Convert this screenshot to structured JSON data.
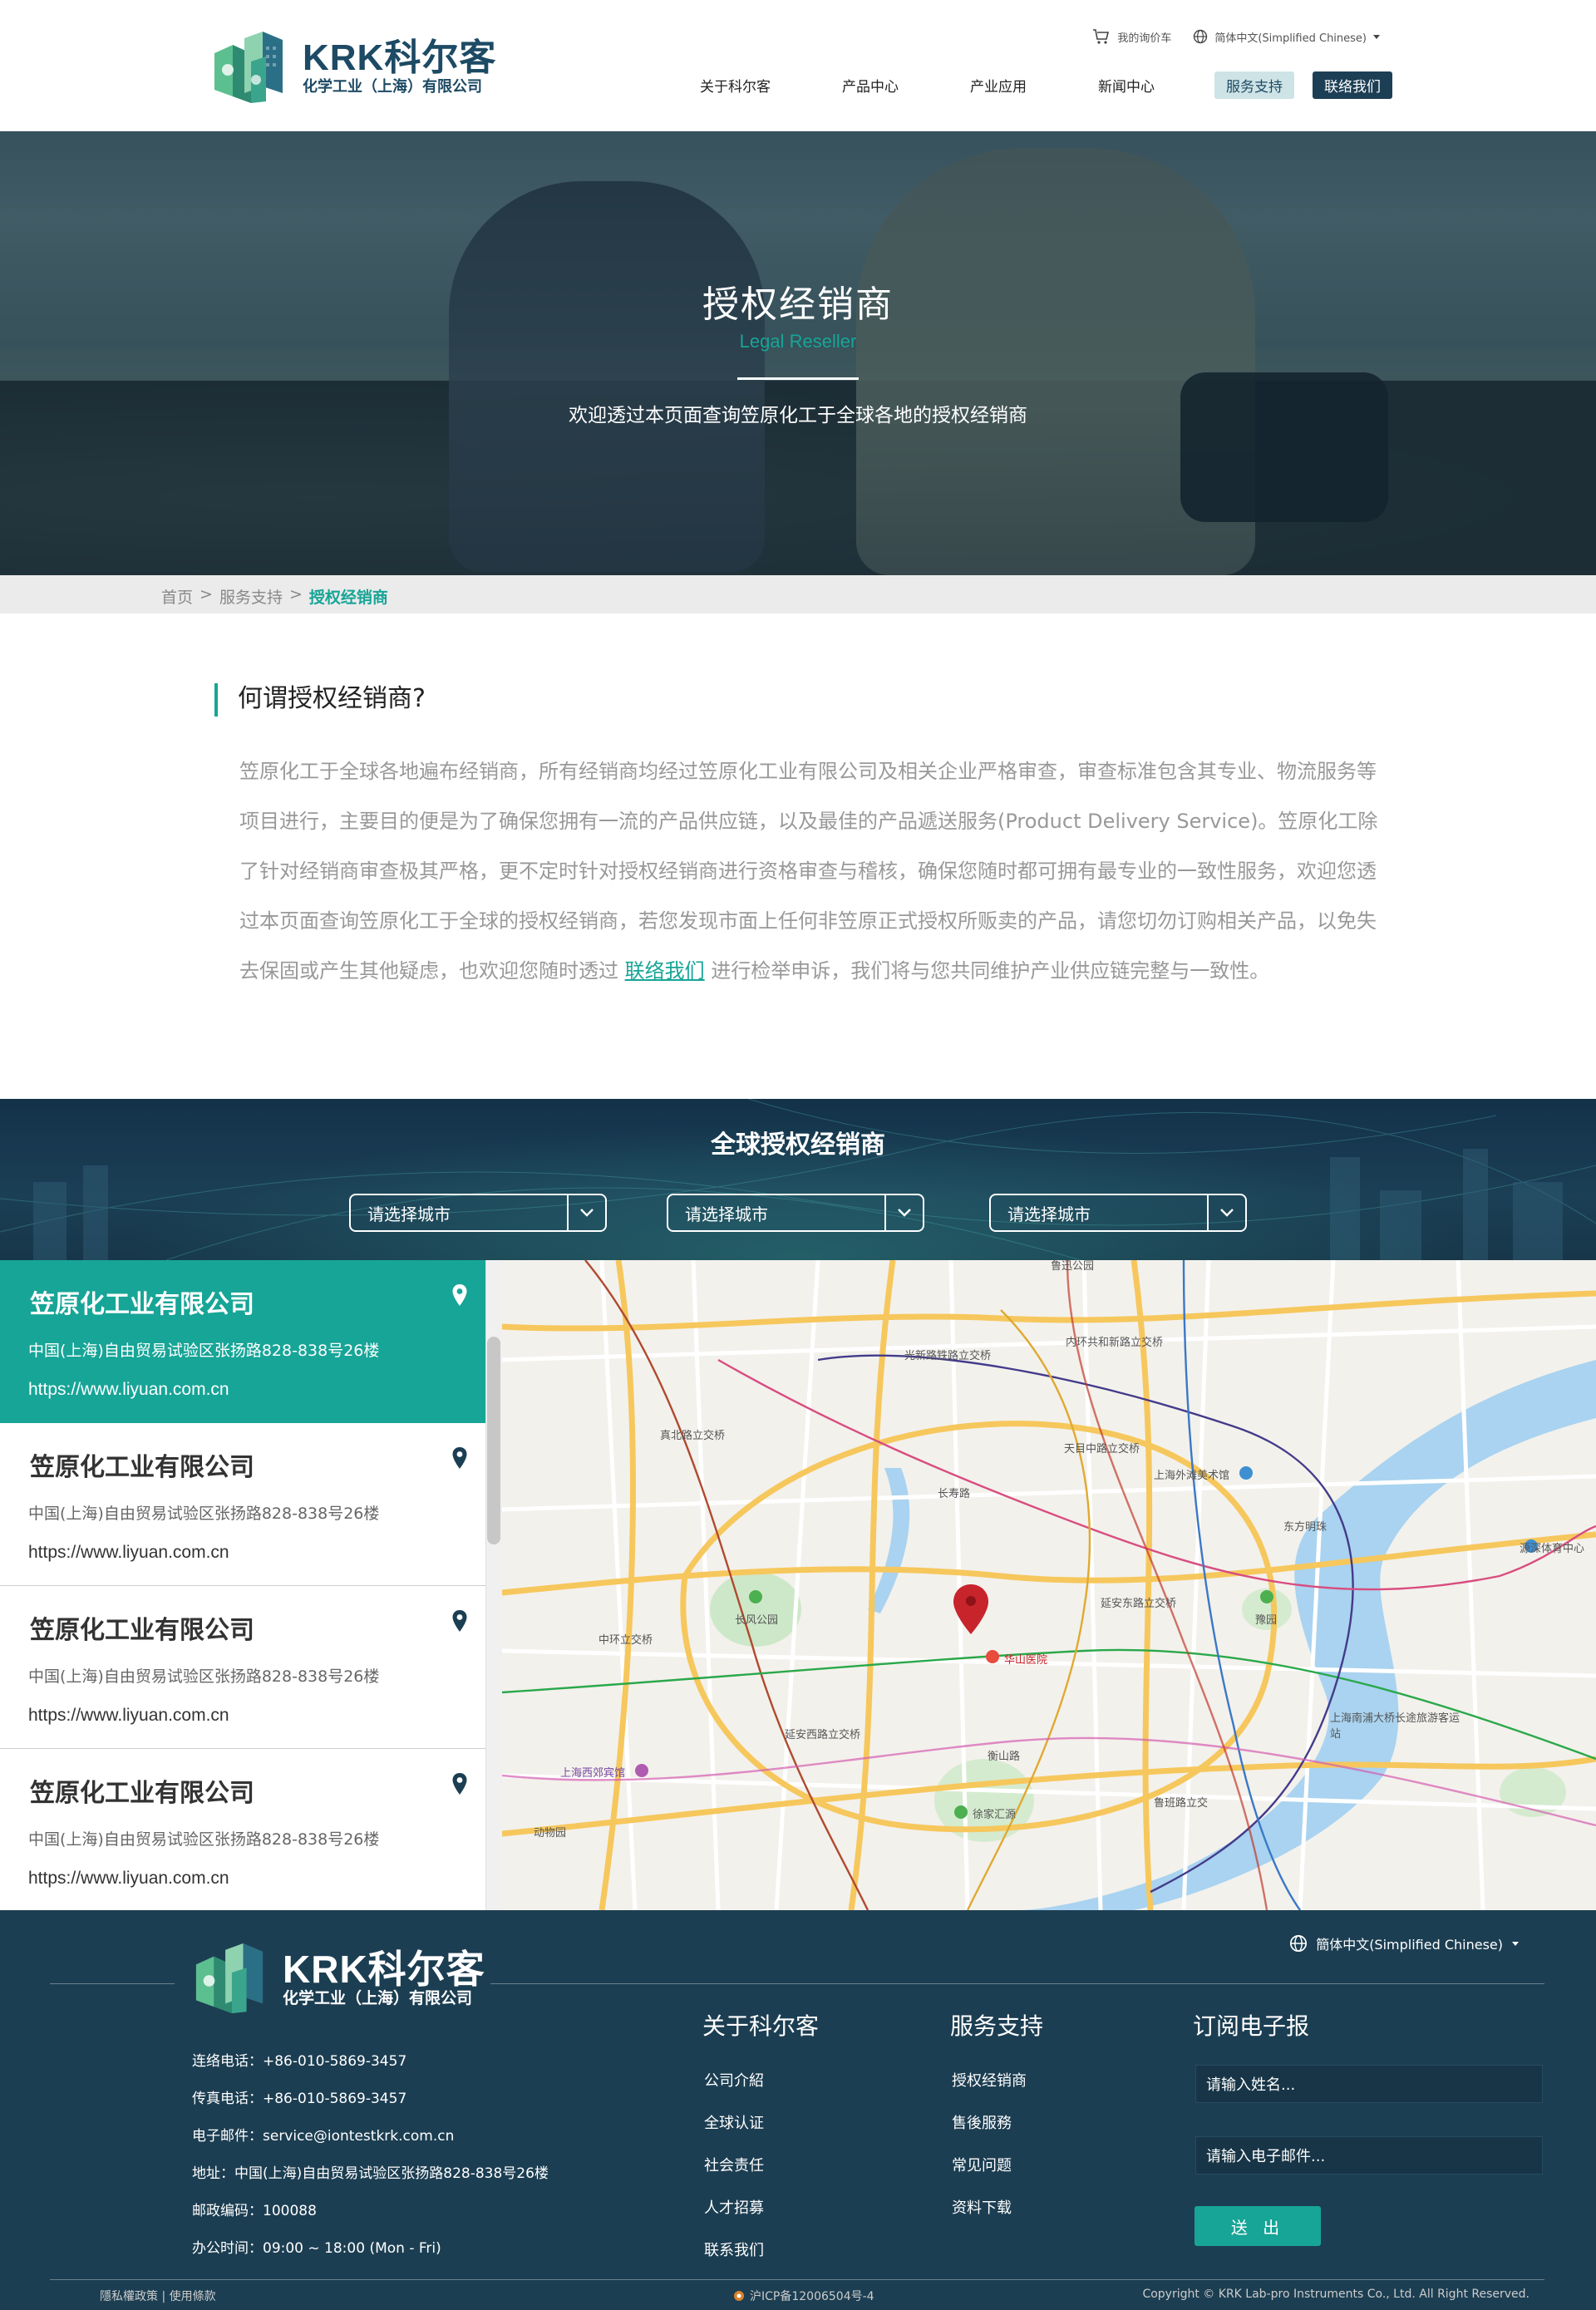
{
  "header": {
    "logo_main": "KRK科尔客",
    "logo_sub": "化学工业（上海）有限公司",
    "util_cart": "我的询价车",
    "util_lang": "简体中文(Simplified Chinese)",
    "nav": [
      {
        "label": "关于科尔客"
      },
      {
        "label": "产品中心"
      },
      {
        "label": "产业应用"
      },
      {
        "label": "新闻中心"
      },
      {
        "label": "服务支持"
      },
      {
        "label": "联络我们"
      }
    ]
  },
  "hero": {
    "title": "授权经销商",
    "subtitle": "Legal Reseller",
    "description": "欢迎透过本页面查询笠原化工于全球各地的授权经销商"
  },
  "breadcrumb": {
    "home": "首页",
    "sep1": ">",
    "parent": "服务支持",
    "sep2": ">",
    "current": "授权经销商"
  },
  "intro": {
    "title": "何谓授权经销商?",
    "text_before_link": "笠原化工于全球各地遍布经销商，所有经销商均经过笠原化工业有限公司及相关企业严格审查，审查标准包含其专业、物流服务等项目进行，主要目的便是为了确保您拥有一流的产品供应链，以及最佳的产品遞送服务(Product Delivery Service)。笠原化工除了针对经销商审查极其严格，更不定时针对授权经销商进行资格审查与稽核，确保您随时都可拥有最专业的一致性服务，欢迎您透过本页面查询笠原化工于全球的授权经销商，若您发现市面上任何非笠原正式授权所贩卖的产品，请您切勿订购相关产品，以免失去保固或产生其他疑虑，也欢迎您随时透过 ",
    "link": "联络我们",
    "text_after_link": " 进行检举申诉，我们将与您共同维护产业供应链完整与一致性。"
  },
  "global": {
    "title": "全球授权经销商",
    "selects": [
      {
        "placeholder": "请选择城市"
      },
      {
        "placeholder": "请选择城市"
      },
      {
        "placeholder": "请选择城市"
      }
    ]
  },
  "dealers": [
    {
      "name": "笠原化工业有限公司",
      "address": "中国(上海)自由贸易试验区张扬路828-838号26楼",
      "url": "https://www.liyuan.com.cn"
    },
    {
      "name": "笠原化工业有限公司",
      "address": "中国(上海)自由贸易试验区张扬路828-838号26楼",
      "url": "https://www.liyuan.com.cn"
    },
    {
      "name": "笠原化工业有限公司",
      "address": "中国(上海)自由贸易试验区张扬路828-838号26楼",
      "url": "https://www.liyuan.com.cn"
    },
    {
      "name": "笠原化工业有限公司",
      "address": "中国(上海)自由贸易试验区张扬路828-838号26楼",
      "url": "https://www.liyuan.com.cn"
    }
  ],
  "map": {
    "labels": [
      "光新路铁路立交桥",
      "内环共和新路立交桥",
      "真北路立交桥",
      "长寿路",
      "天目中路立交桥",
      "上海外滩美术馆",
      "东方明珠",
      "源深体育中心",
      "长风公园",
      "延安东路立交桥",
      "豫园",
      "中环立交桥",
      "华山医院",
      "延安西路立交桥",
      "上海西郊宾馆",
      "衡山路",
      "徐家汇源",
      "鲁班路立交",
      "上海南浦大桥长途旅游客运站",
      "动物园",
      "鲁迅公园"
    ]
  },
  "footer": {
    "logo_main": "KRK科尔客",
    "logo_sub": "化学工业（上海）有限公司",
    "lang": "簡体中文(Simplified Chinese)",
    "contact": [
      "连络电话：+86-010-5869-3457",
      "传真电话：+86-010-5869-3457",
      "电子邮件：service@iontestkrk.com.cn",
      "地址：中国(上海)自由贸易试验区张扬路828-838号26楼",
      "邮政编码：100088",
      "办公时间：09:00 ~ 18:00 (Mon - Fri)"
    ],
    "col1_title": "关于科尔客",
    "col1": [
      "公司介紹",
      "全球认证",
      "社会责任",
      "人才招募",
      "联系我们"
    ],
    "col2_title": "服务支持",
    "col2": [
      "授权经销商",
      "售後服務",
      "常见问题",
      "资料下载"
    ],
    "col3_title": "订阅电子报",
    "name_placeholder": "请输入姓名...",
    "email_placeholder": "请输入电子邮件...",
    "submit": "送 出",
    "policy": "隱私權政策 | 使用條款",
    "icp": "沪ICP备12006504号-4",
    "copyright": "Copyright © KRK Lab-pro Instruments Co., Ltd. All Right Reserved."
  },
  "colors": {
    "accent": "#17a597",
    "navy": "#1c3e52",
    "logo": "#1d4a64"
  }
}
